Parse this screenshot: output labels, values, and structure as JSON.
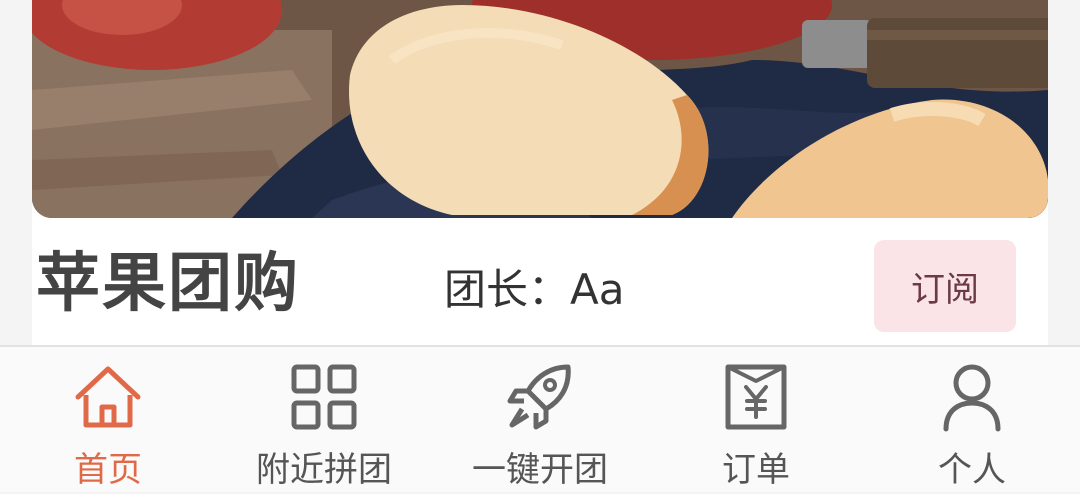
{
  "hero": {
    "image": "apple-slices-photo"
  },
  "group": {
    "title": "苹果团购",
    "leader_text": "团长：Aa",
    "subscribe_label": "订阅"
  },
  "tabbar": {
    "active_color": "#e06a48",
    "inactive_color": "#555555",
    "items": [
      {
        "label": "首页",
        "icon": "home-icon",
        "active": true
      },
      {
        "label": "附近拼团",
        "icon": "grid-icon",
        "active": false
      },
      {
        "label": "一键开团",
        "icon": "rocket-icon",
        "active": false
      },
      {
        "label": "订单",
        "icon": "receipt-icon",
        "active": false
      },
      {
        "label": "个人",
        "icon": "person-icon",
        "active": false
      }
    ]
  }
}
